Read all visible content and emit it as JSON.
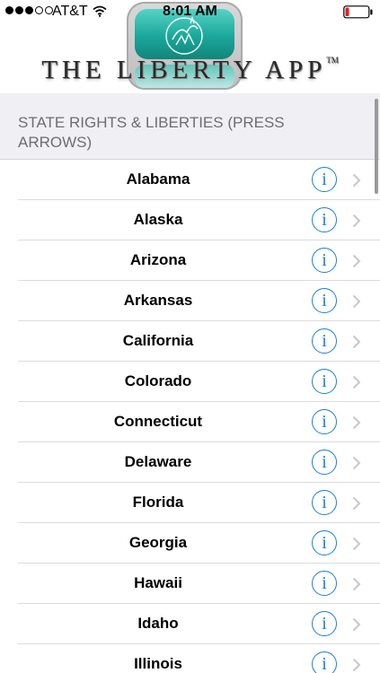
{
  "status_bar": {
    "carrier": "AT&T",
    "time": "8:01 AM",
    "signal_bars_filled": 3,
    "signal_bars_total": 5
  },
  "header": {
    "logo_icon": "liberty-app-icon",
    "banner_title": "THE LIBERTY APP",
    "trademark": "TM"
  },
  "section": {
    "title": "STATE RIGHTS & LIBERTIES (PRESS ARROWS)"
  },
  "states": [
    {
      "label": "Alabama"
    },
    {
      "label": "Alaska"
    },
    {
      "label": "Arizona"
    },
    {
      "label": "Arkansas"
    },
    {
      "label": "California"
    },
    {
      "label": "Colorado"
    },
    {
      "label": "Connecticut"
    },
    {
      "label": "Delaware"
    },
    {
      "label": "Florida"
    },
    {
      "label": "Georgia"
    },
    {
      "label": "Hawaii"
    },
    {
      "label": "Idaho"
    },
    {
      "label": "Illinois"
    }
  ],
  "accent_color": "#1a7fd6",
  "battery_color": "#e02020"
}
